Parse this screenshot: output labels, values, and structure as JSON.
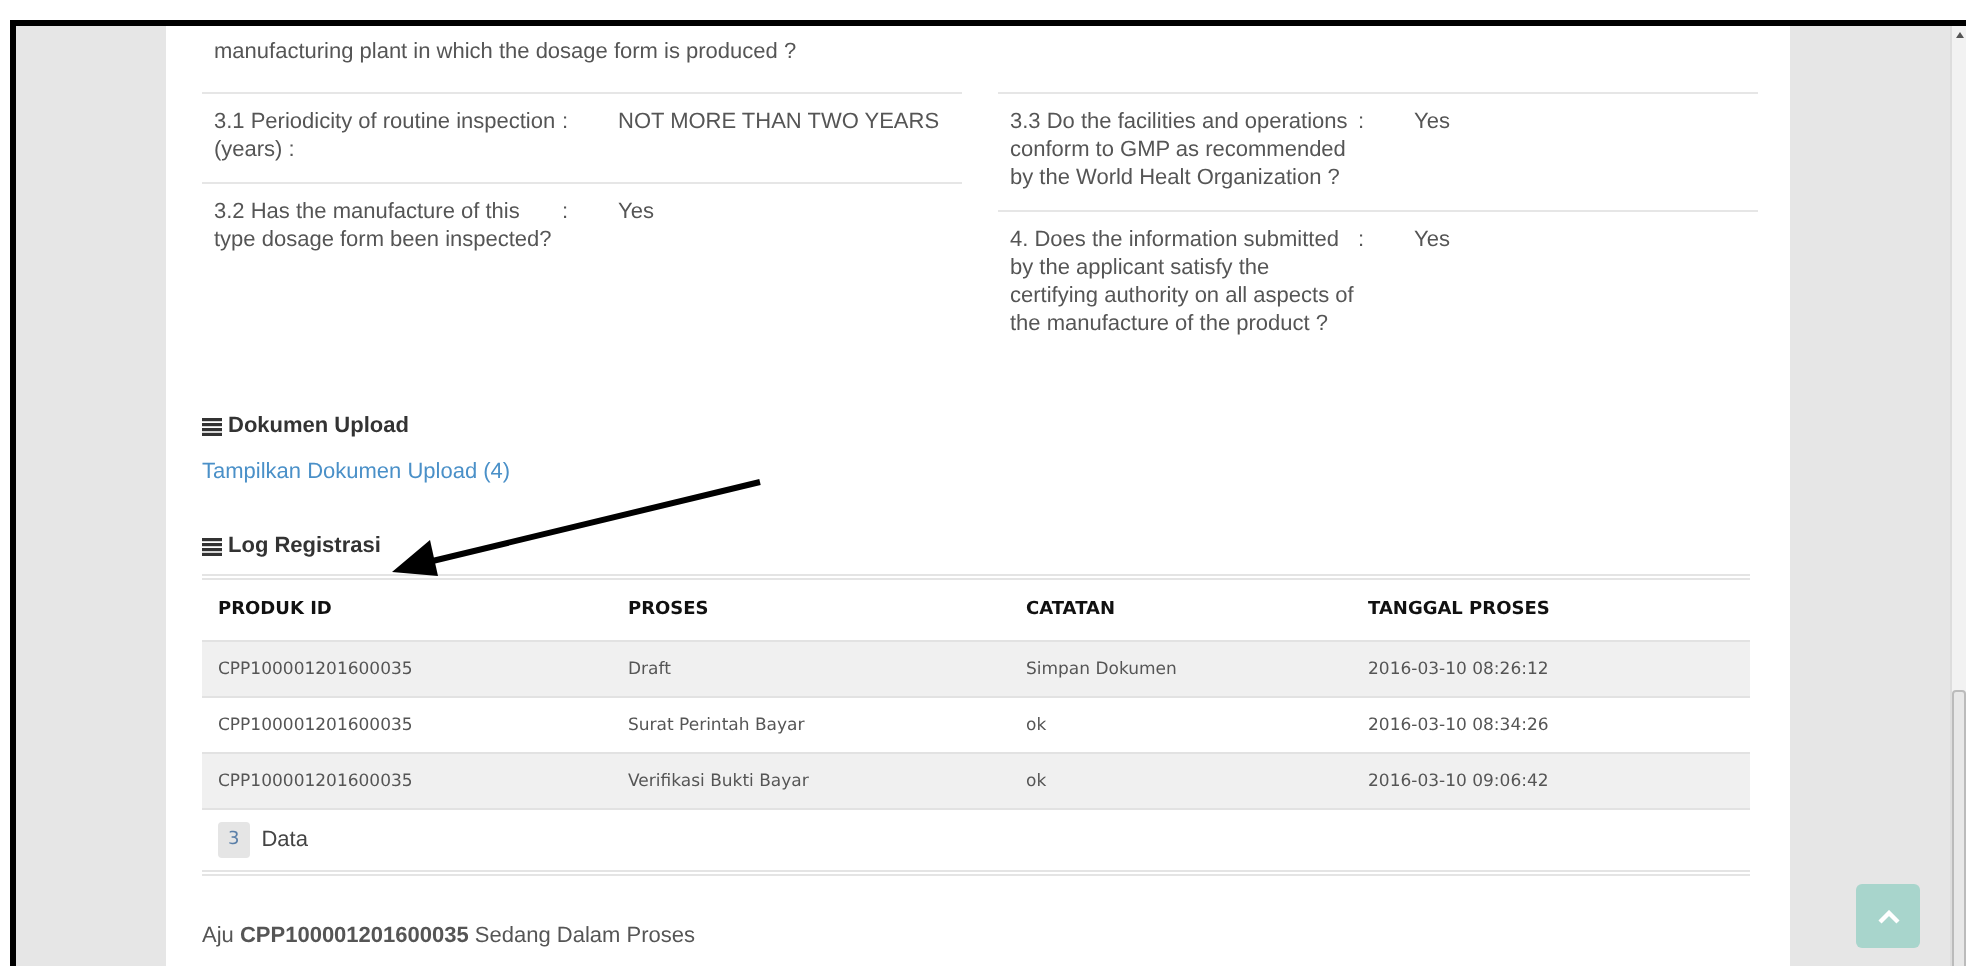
{
  "intro_question": "manufacturing plant in which the dosage form is produced ?",
  "inspection_left": [
    {
      "question": "3.1 Periodicity of routine inspection (years) :",
      "separator": ":",
      "answer": "NOT MORE THAN TWO YEARS"
    },
    {
      "question": "3.2 Has the manufacture of this type dosage form been inspected?",
      "separator": ":",
      "answer": "Yes"
    }
  ],
  "inspection_right": [
    {
      "question": "3.3 Do the facilities and operations conform to GMP as recommended by the World Healt Organization ?",
      "separator": ":",
      "answer": "Yes"
    },
    {
      "question": "4. Does the information submitted by the applicant satisfy the certifying authority on all aspects of the manufacture of the product ?",
      "separator": ":",
      "answer": "Yes"
    }
  ],
  "dokumen_upload": {
    "heading": "Dokumen Upload",
    "link": "Tampilkan Dokumen Upload (4)"
  },
  "log_registrasi": {
    "heading": "Log Registrasi",
    "columns": [
      "PRODUK ID",
      "PROSES",
      "CATATAN",
      "TANGGAL PROSES"
    ],
    "rows": [
      [
        "CPP100001201600035",
        "Draft",
        "Simpan Dokumen",
        "2016-03-10 08:26:12"
      ],
      [
        "CPP100001201600035",
        "Surat Perintah Bayar",
        "ok",
        "2016-03-10 08:34:26"
      ],
      [
        "CPP100001201600035",
        "Verifikasi Bukti Bayar",
        "ok",
        "2016-03-10 09:06:42"
      ]
    ],
    "count": "3",
    "count_label": "Data"
  },
  "status_message": "Aju **CPP100001201600035** Sedang Dalam Proses"
}
